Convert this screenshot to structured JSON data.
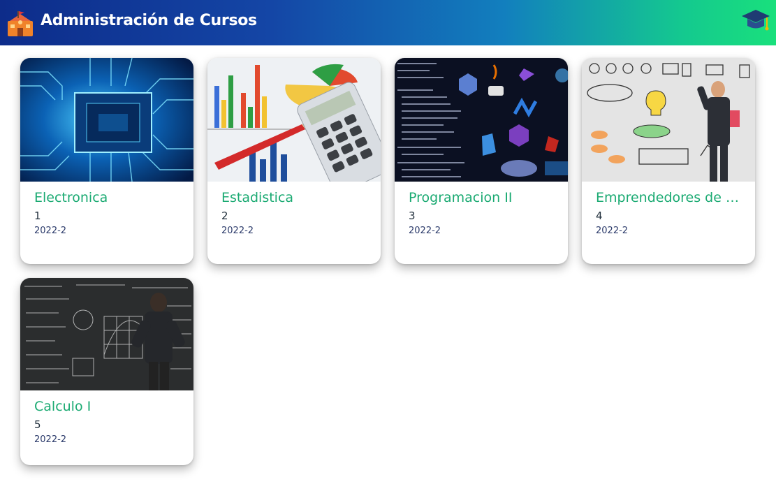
{
  "header": {
    "title": "Administración de Cursos",
    "logo_icon": "school-building-icon",
    "user_icon": "graduation-cap-icon"
  },
  "courses": [
    {
      "name": "Electronica",
      "number": "1",
      "period": "2022-2",
      "thumb": "circuit-board-image"
    },
    {
      "name": "Estadistica",
      "number": "2",
      "period": "2022-2",
      "thumb": "statistics-calculator-image"
    },
    {
      "name": "Programacion II",
      "number": "3",
      "period": "2022-2",
      "thumb": "programming-languages-image"
    },
    {
      "name": "Emprendedores de n...",
      "number": "4",
      "period": "2022-2",
      "thumb": "entrepreneur-whiteboard-image"
    },
    {
      "name": "Calculo I",
      "number": "5",
      "period": "2022-2",
      "thumb": "math-chalkboard-image"
    }
  ],
  "colors": {
    "header_start": "#0d2c8a",
    "header_end": "#19e07c",
    "course_name": "#1aaa72"
  }
}
